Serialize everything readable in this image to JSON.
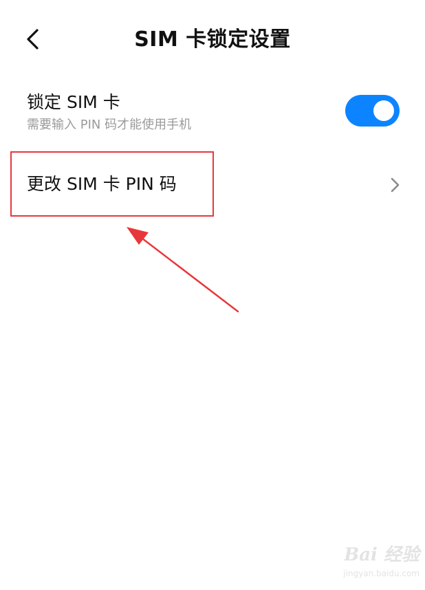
{
  "header": {
    "title": "SIM 卡锁定设置",
    "back_icon": "chevron-left-icon"
  },
  "lock_sim": {
    "title": "锁定 SIM 卡",
    "subtitle": "需要输入 PIN 码才能使用手机",
    "toggle_on": true,
    "toggle_color": "#0d84ff"
  },
  "change_pin": {
    "title": "更改 SIM 卡 PIN 码",
    "chevron_icon": "chevron-right-icon"
  },
  "annotation": {
    "highlight_color": "#e8373b",
    "arrow_color": "#e8373b"
  },
  "watermark": {
    "main": "Bai 经验",
    "sub": "jingyan.baidu.com"
  }
}
